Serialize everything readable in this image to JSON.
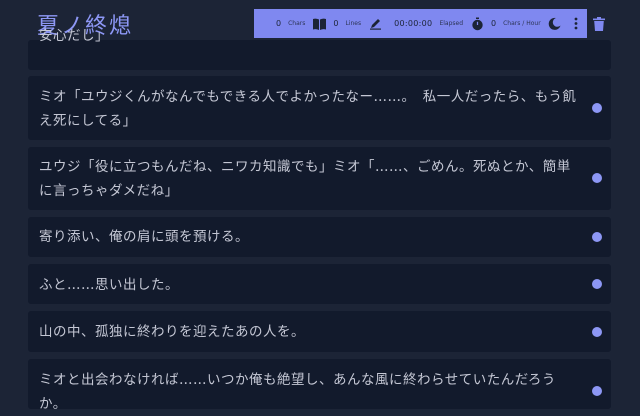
{
  "app": {
    "title": "夏ノ終熄"
  },
  "toolbar": {
    "chars_count": "0",
    "chars_label": "Chars",
    "lines_count": "0",
    "lines_label": "Lines",
    "elapsed_time": "00:00:00",
    "elapsed_label": "Elapsed",
    "rate_count": "0",
    "rate_label": "Chars / Hour",
    "icons": [
      "book-icon",
      "pen-icon",
      "stopwatch-icon",
      "moon-icon",
      "more-vertical-icon",
      "trash-icon"
    ],
    "bg_color": "#7f88f0"
  },
  "colors": {
    "background": "#1c2436",
    "card": "#121a2c",
    "accent": "#8d97f5",
    "text": "#c4c7d4"
  },
  "lines": [
    {
      "text": "安心だし」"
    },
    {
      "text": "ミオ「ユウジくんがなんでもできる人でよかったなー……。　私一人だったら、もう飢え死にしてる」"
    },
    {
      "text": "ユウジ「役に立つもんだね、ニワカ知識でも」ミオ「……、ごめん。死ぬとか、簡単に言っちゃダメだね」"
    },
    {
      "text": "寄り添い、俺の肩に頭を預ける。"
    },
    {
      "text": "ふと……思い出した。"
    },
    {
      "text": "山の中、孤独に終わりを迎えたあの人を。"
    },
    {
      "text": "ミオと出会わなければ……いつか俺も絶望し、あんな風に終わらせていたんだろうか。"
    }
  ]
}
